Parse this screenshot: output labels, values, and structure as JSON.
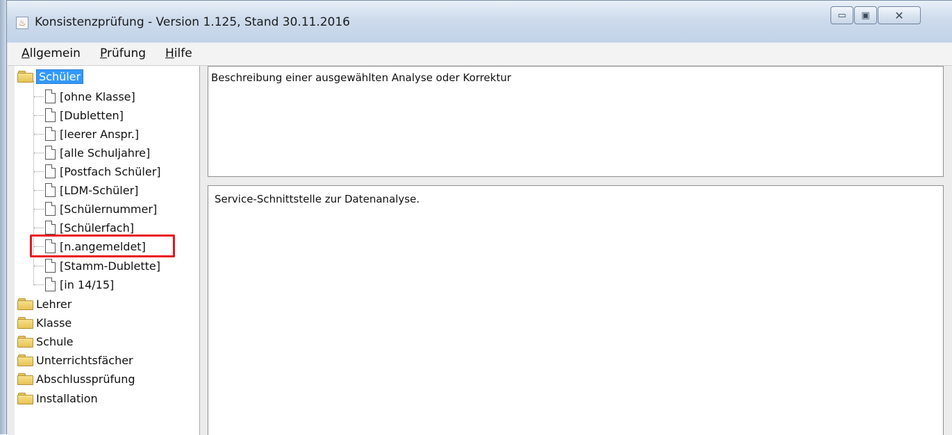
{
  "window": {
    "title": "Konsistenzprüfung - Version 1.125, Stand 30.11.2016",
    "icon": "java-cup-icon",
    "controls": {
      "minimize": "▭",
      "maximize": "▣",
      "close": "✕"
    }
  },
  "menu": [
    {
      "label": "Allgemein",
      "mnemonic": "A"
    },
    {
      "label": "Prüfung",
      "mnemonic": "P"
    },
    {
      "label": "Hilfe",
      "mnemonic": "H"
    }
  ],
  "tree": {
    "root": {
      "label": "Schüler",
      "icon": "folder-icon",
      "selected": true
    },
    "children": [
      "[ohne Klasse]",
      "[Dubletten]",
      "[leerer Anspr.]",
      "[alle Schuljahre]",
      "[Postfach Schüler]",
      "[LDM-Schüler]",
      "[Schülernummer]",
      "[Schülerfach]",
      "[n.angemeldet]",
      "[Stamm-Dublette]",
      "[in 14/15]"
    ],
    "folders": [
      "Lehrer",
      "Klasse",
      "Schule",
      "Unterrichtsfächer",
      "Abschlussprüfung",
      "Installation"
    ],
    "highlighted_item": "[n.angemeldet]",
    "highlight_color": "#e8141b"
  },
  "description_pane": {
    "text": "Beschreibung einer ausgewählten Analyse oder Korrektur"
  },
  "output_pane": {
    "text": "Service-Schnittstelle zur Datenanalyse."
  }
}
